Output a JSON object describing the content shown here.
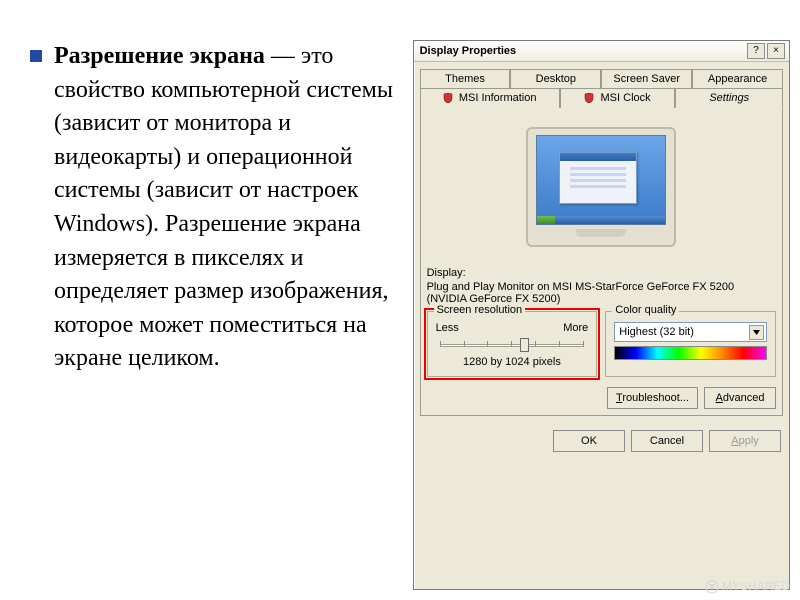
{
  "slide": {
    "bullet_bold": "Разрешение экрана",
    "bullet_rest": " — это свойство компьютерной системы (зависит от монитора и видеокарты) и операционной системы (зависит от настроек Windows). Разрешение экрана измеряется в пикселях и определяет размер изображения, которое может поместиться на экране целиком."
  },
  "watermark": "MYSHARED",
  "dialog": {
    "title": "Display Properties",
    "sys": {
      "help": "?",
      "close": "×"
    },
    "tabs_row1": [
      "Themes",
      "Desktop",
      "Screen Saver",
      "Appearance"
    ],
    "tabs_row2": {
      "msi_info": "MSI Information",
      "msi_clock": "MSI Clock",
      "settings": "Settings"
    },
    "display_label": "Display:",
    "display_value": "Plug and Play Monitor on MSI MS-StarForce GeForce FX 5200 (NVIDIA GeForce FX 5200)",
    "resolution": {
      "legend": "Screen resolution",
      "less": "Less",
      "more": "More",
      "value": "1280 by 1024 pixels"
    },
    "quality": {
      "legend": "Color quality",
      "selected": "Highest (32 bit)"
    },
    "buttons": {
      "troubleshoot": "Troubleshoot...",
      "advanced": "Advanced",
      "ok": "OK",
      "cancel": "Cancel",
      "apply": "Apply"
    }
  }
}
